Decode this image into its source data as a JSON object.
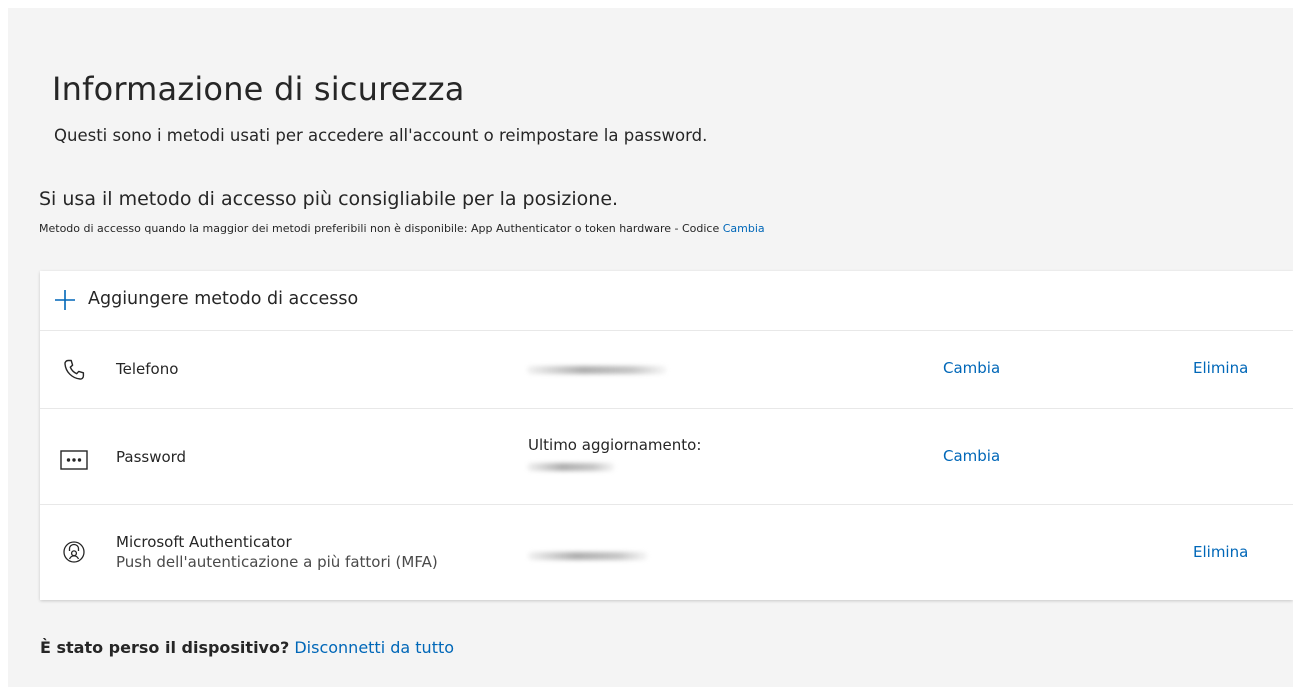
{
  "header": {
    "title": "Informazione di sicurezza",
    "subtitle": "Questi sono i metodi usati per accedere all'account o reimpostare la password."
  },
  "default_method": {
    "heading": "Si usa il metodo di accesso più consigliabile per la posizione.",
    "note": "Metodo di accesso quando la maggior dei metodi preferibili non è disponibile: App Authenticator o token hardware - Codice",
    "change_link": "Cambia"
  },
  "methods": {
    "add_label": "Aggiungere metodo di accesso",
    "rows": [
      {
        "name": "Telefono",
        "icon": "phone-icon",
        "detail": "",
        "change": "Cambia",
        "delete": "Elimina"
      },
      {
        "name": "Password",
        "icon": "password-dots-icon",
        "detail": "Ultimo aggiornamento:",
        "change": "Cambia",
        "delete": ""
      },
      {
        "name": "Microsoft Authenticator",
        "subtitle": "Push dell'autenticazione a più fattori (MFA)",
        "icon": "authenticator-lock-icon",
        "detail": "",
        "change": "",
        "delete": "Elimina"
      }
    ]
  },
  "footer": {
    "question": "È stato perso il dispositivo?",
    "link": "Disconnetti da tutto"
  },
  "colors": {
    "accent": "#0067b8",
    "page_background": "#f4f4f4",
    "card_background": "#ffffff",
    "text": "#262626"
  }
}
